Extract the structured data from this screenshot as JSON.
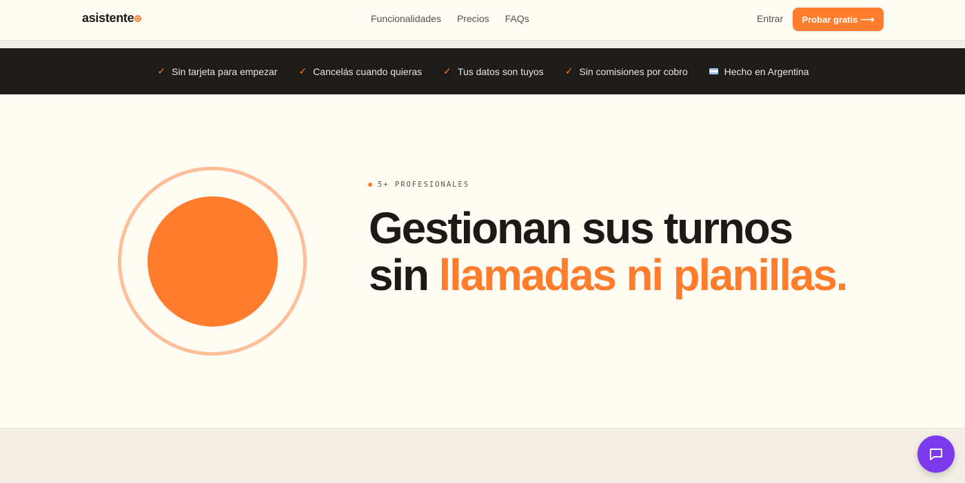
{
  "header": {
    "logo_text": "asistente",
    "nav": [
      {
        "label": "Funcionalidades"
      },
      {
        "label": "Precios"
      },
      {
        "label": "FAQs"
      }
    ],
    "login_label": "Entrar",
    "cta_label": "Probar gratis",
    "cta_arrow": "⟶"
  },
  "features": [
    {
      "icon": "check-icon",
      "label": "Sin tarjeta para empezar"
    },
    {
      "icon": "check-icon",
      "label": "Cancelás cuando quieras"
    },
    {
      "icon": "check-icon",
      "label": "Tus datos son tuyos"
    },
    {
      "icon": "check-icon",
      "label": "Sin comisiones por cobro"
    },
    {
      "icon": "argentina-flag-icon",
      "label": "Hecho en Argentina"
    }
  ],
  "hero": {
    "eyebrow": "5+ PROFESIONALES",
    "headline_part1": "Gestionan sus turnos sin",
    "headline_accent": "llamadas ni planillas."
  },
  "chat_button": {
    "icon": "chat-icon"
  },
  "colors": {
    "accent": "#ff7d2c",
    "accent_light": "#ffbd98",
    "dark_bar": "#1e1c19",
    "background": "#fffcf4",
    "chat": "#7c3aed"
  }
}
